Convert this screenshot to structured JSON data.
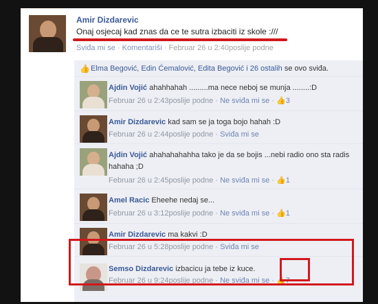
{
  "post": {
    "author": "Amir Dizdarevic",
    "status": "Onaj osjecaj kad znas da ce te sutra izbaciti iz skole :///",
    "like_link": "Sviđa mi se",
    "sep": "·",
    "comment_link": "Komentariši",
    "time": "Februar 26 u 2:40poslije podne"
  },
  "likes": {
    "icon": "thumbs-up-icon",
    "names": "Elma Begović, Edin Ćemalović, Edita Begović i 26 ostalih",
    "suffix": "se ovo sviđa."
  },
  "comments": [
    {
      "name": "Ajdin Vojić",
      "text": "ahahhahah .........ma nece neboj se munja ........:D",
      "time": "Februar 26 u 2:43poslije podne",
      "action": "Ne sviđa mi se",
      "likes": "3"
    },
    {
      "name": "Amir Dizdarevic",
      "text": "kad sam se ja toga bojo hahah :D",
      "time": "Februar 26 u 2:44poslije podne",
      "action": "Sviđa mi se",
      "likes": ""
    },
    {
      "name": "Ajdin Vojić",
      "text": "ahahahahahha tako je da se bojis ...nebi radio ono sta radis hahaha ;D",
      "time": "Februar 26 u 2:45poslije podne",
      "action": "Ne sviđa mi se",
      "likes": "1"
    },
    {
      "name": "Amel Racic",
      "text": "Eheehe nedaj se...",
      "time": "Februar 26 u 3:12poslije podne",
      "action": "Ne sviđa mi se",
      "likes": "1"
    },
    {
      "name": "Amir Dizdarevic",
      "text": "ma kakvi :D",
      "time": "Februar 26 u 5:28poslije podne",
      "action": "Sviđa mi se",
      "likes": ""
    },
    {
      "name": "Semso Dizdarevic",
      "text": "izbacicu ja tebe iz kuce.",
      "time": "Februar 26 u 9:24poslije podne",
      "action": "Ne sviđa mi se",
      "likes": "7"
    }
  ],
  "colors": {
    "link": "#3b5998",
    "highlight": "#d3171c",
    "panel": "#edeff4"
  }
}
